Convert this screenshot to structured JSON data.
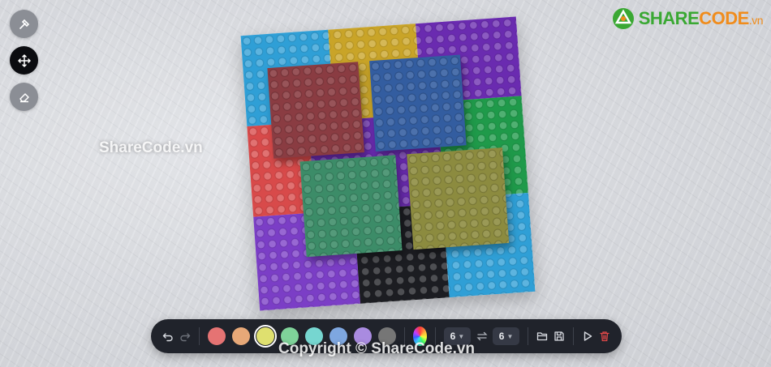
{
  "tools": [
    {
      "name": "hammer-icon",
      "active": false
    },
    {
      "name": "move-icon",
      "active": true
    },
    {
      "name": "eraser-icon",
      "active": false
    }
  ],
  "logo": {
    "brand_green": "SHARE",
    "brand_orange": "CODE",
    "suffix": ".vn"
  },
  "watermarks": {
    "mid": "ShareCode.vn",
    "bottom": "Copyright © ShareCode.vn"
  },
  "toolbar": {
    "undo_icon": "undo-icon",
    "redo_icon": "redo-icon",
    "colors": [
      "#e57373",
      "#e7a878",
      "#dfe06f",
      "#7fd39a",
      "#76d6d0",
      "#7ea7e0",
      "#a98be0",
      "#767676"
    ],
    "selected_color_index": 2,
    "width_value": "6",
    "depth_value": "6",
    "swap_icon": "swap-icon",
    "open_icon": "folder-open-icon",
    "save_icon": "save-icon",
    "play_icon": "play-icon",
    "delete_icon": "trash-icon"
  },
  "board_colors": {
    "cyan": "#2f9fd6",
    "gold": "#c9a428",
    "purple": "#6a2bb0",
    "red": "#d84a4a",
    "green": "#1f9a4a",
    "black": "#1c1d22",
    "violet": "#7b3ec6",
    "piece_red": "#8a3c42",
    "piece_blue": "#335da0",
    "piece_green": "#3c8c68",
    "piece_olive": "#8c8b3f"
  }
}
